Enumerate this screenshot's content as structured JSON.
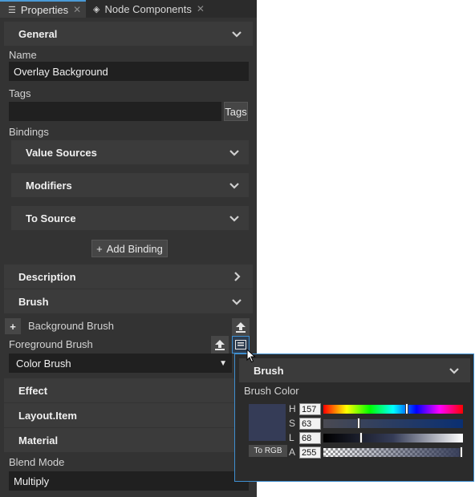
{
  "tabs": [
    {
      "label": "Properties",
      "icon": "list-icon",
      "active": true
    },
    {
      "label": "Node Components",
      "icon": "components-icon",
      "active": false
    }
  ],
  "general": {
    "header": "General",
    "name_label": "Name",
    "name_value": "Overlay Background",
    "tags_label": "Tags",
    "tags_value": "",
    "tags_button": "Tags",
    "bindings_label": "Bindings",
    "bindings": [
      "Value Sources",
      "Modifiers",
      "To Source"
    ],
    "add_binding": "Add Binding"
  },
  "sections": {
    "description": "Description",
    "brush": "Brush",
    "effect": "Effect",
    "layout": "Layout.Item",
    "material": "Material"
  },
  "brush": {
    "background_label": "Background Brush",
    "foreground_label": "Foreground Brush",
    "foreground_value": "Color Brush"
  },
  "material": {
    "blend_label": "Blend Mode",
    "blend_value": "Multiply"
  },
  "popup": {
    "header": "Brush",
    "color_label": "Brush Color",
    "to_rgb": "To RGB",
    "swatch_color": "#353c57",
    "channels": [
      {
        "name": "H",
        "value": "157",
        "fraction": 0.6
      },
      {
        "name": "S",
        "value": "63",
        "fraction": 0.25
      },
      {
        "name": "L",
        "value": "68",
        "fraction": 0.27
      },
      {
        "name": "A",
        "value": "255",
        "fraction": 1.0
      }
    ]
  },
  "colors": {
    "accent": "#3f8fd0",
    "panel": "#333333",
    "section": "#3b3b3b"
  }
}
